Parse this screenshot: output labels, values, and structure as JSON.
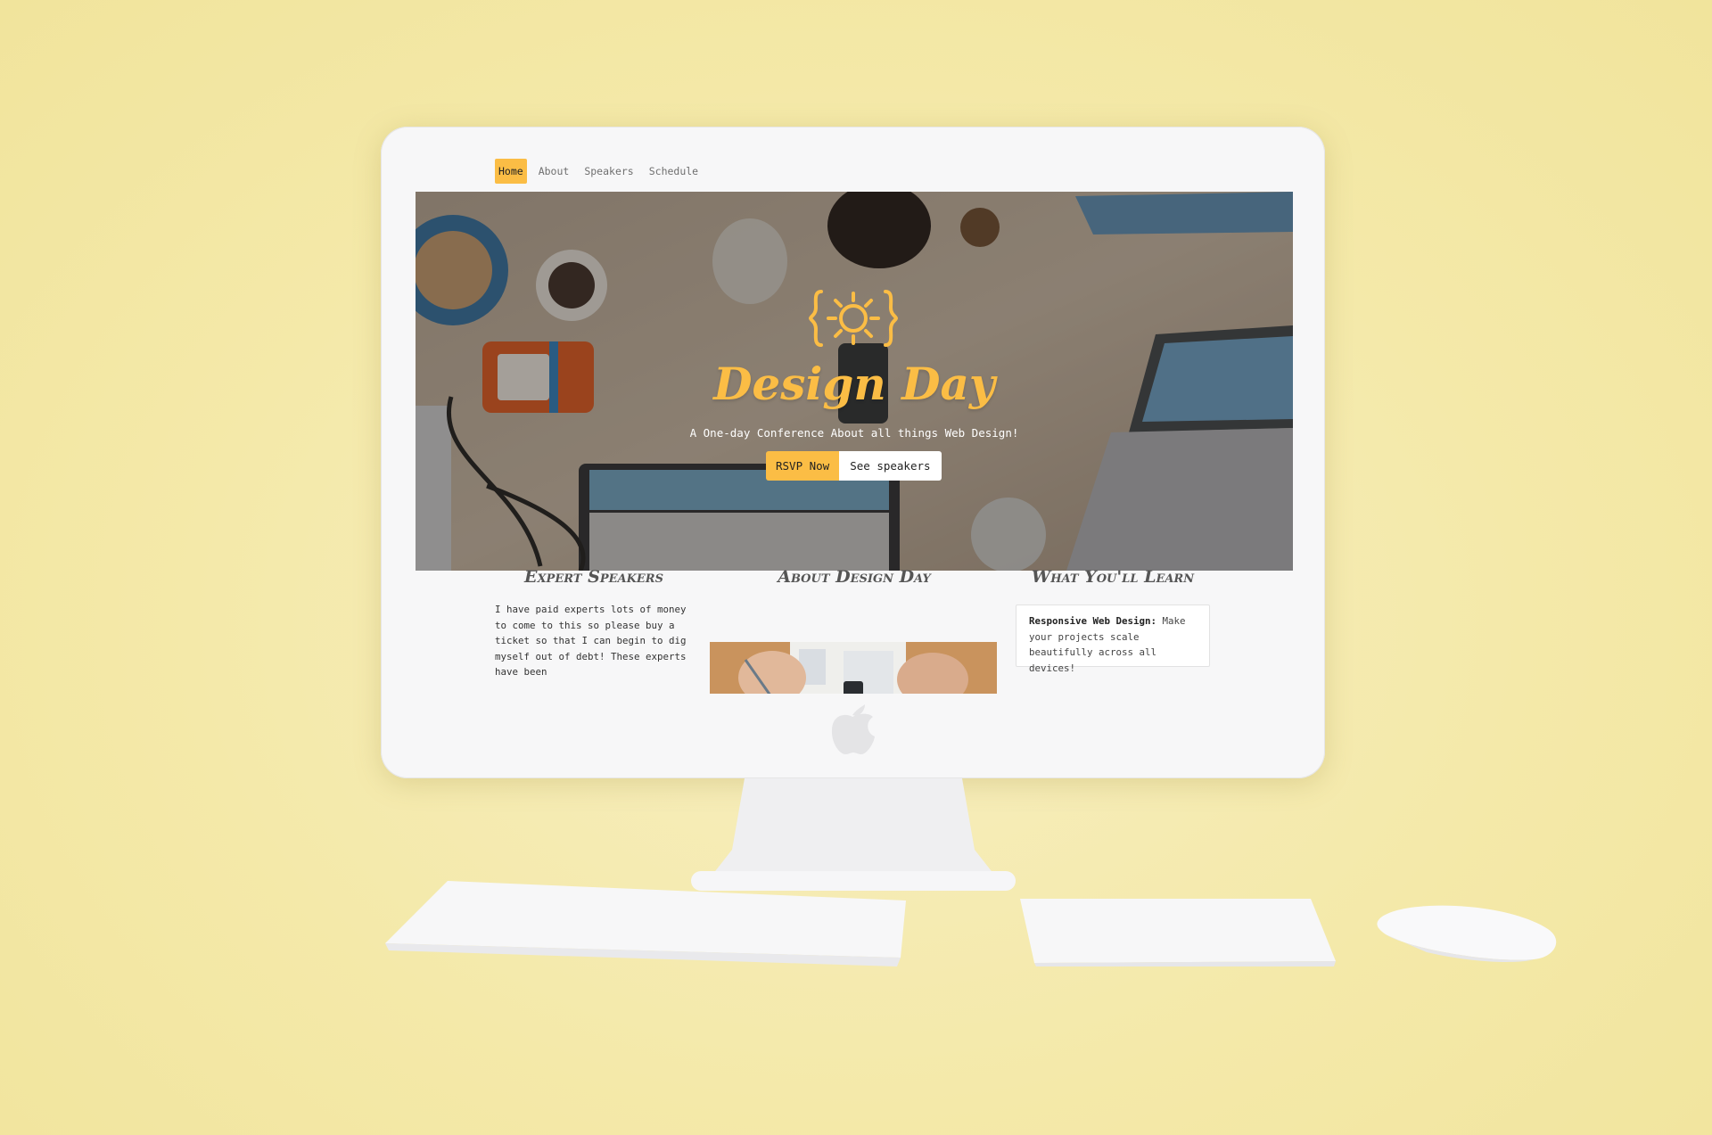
{
  "nav": {
    "items": [
      {
        "label": "Home",
        "active": true
      },
      {
        "label": "About",
        "active": false
      },
      {
        "label": "Speakers",
        "active": false
      },
      {
        "label": "Schedule",
        "active": false
      }
    ]
  },
  "hero": {
    "title": "Design Day",
    "subtitle": "A One-day Conference About all things Web Design!",
    "rsvp_label": "RSVP Now",
    "speakers_label": "See speakers",
    "logo_icon": "sun-braces-icon"
  },
  "sections": {
    "speakers": {
      "title": "Expert Speakers",
      "text": "I have paid experts lots of money to come to this so please buy a ticket so that I can begin to dig myself out of debt! These experts have been"
    },
    "about": {
      "title": "About Design Day"
    },
    "learn": {
      "title": "What You'll Learn",
      "item_title": "Responsive Web Design:",
      "item_text": " Make your projects scale beautifully across all devices!"
    }
  },
  "colors": {
    "accent": "#fbbd45",
    "background": "#f3e8a8",
    "device": "#f7f7f8"
  }
}
